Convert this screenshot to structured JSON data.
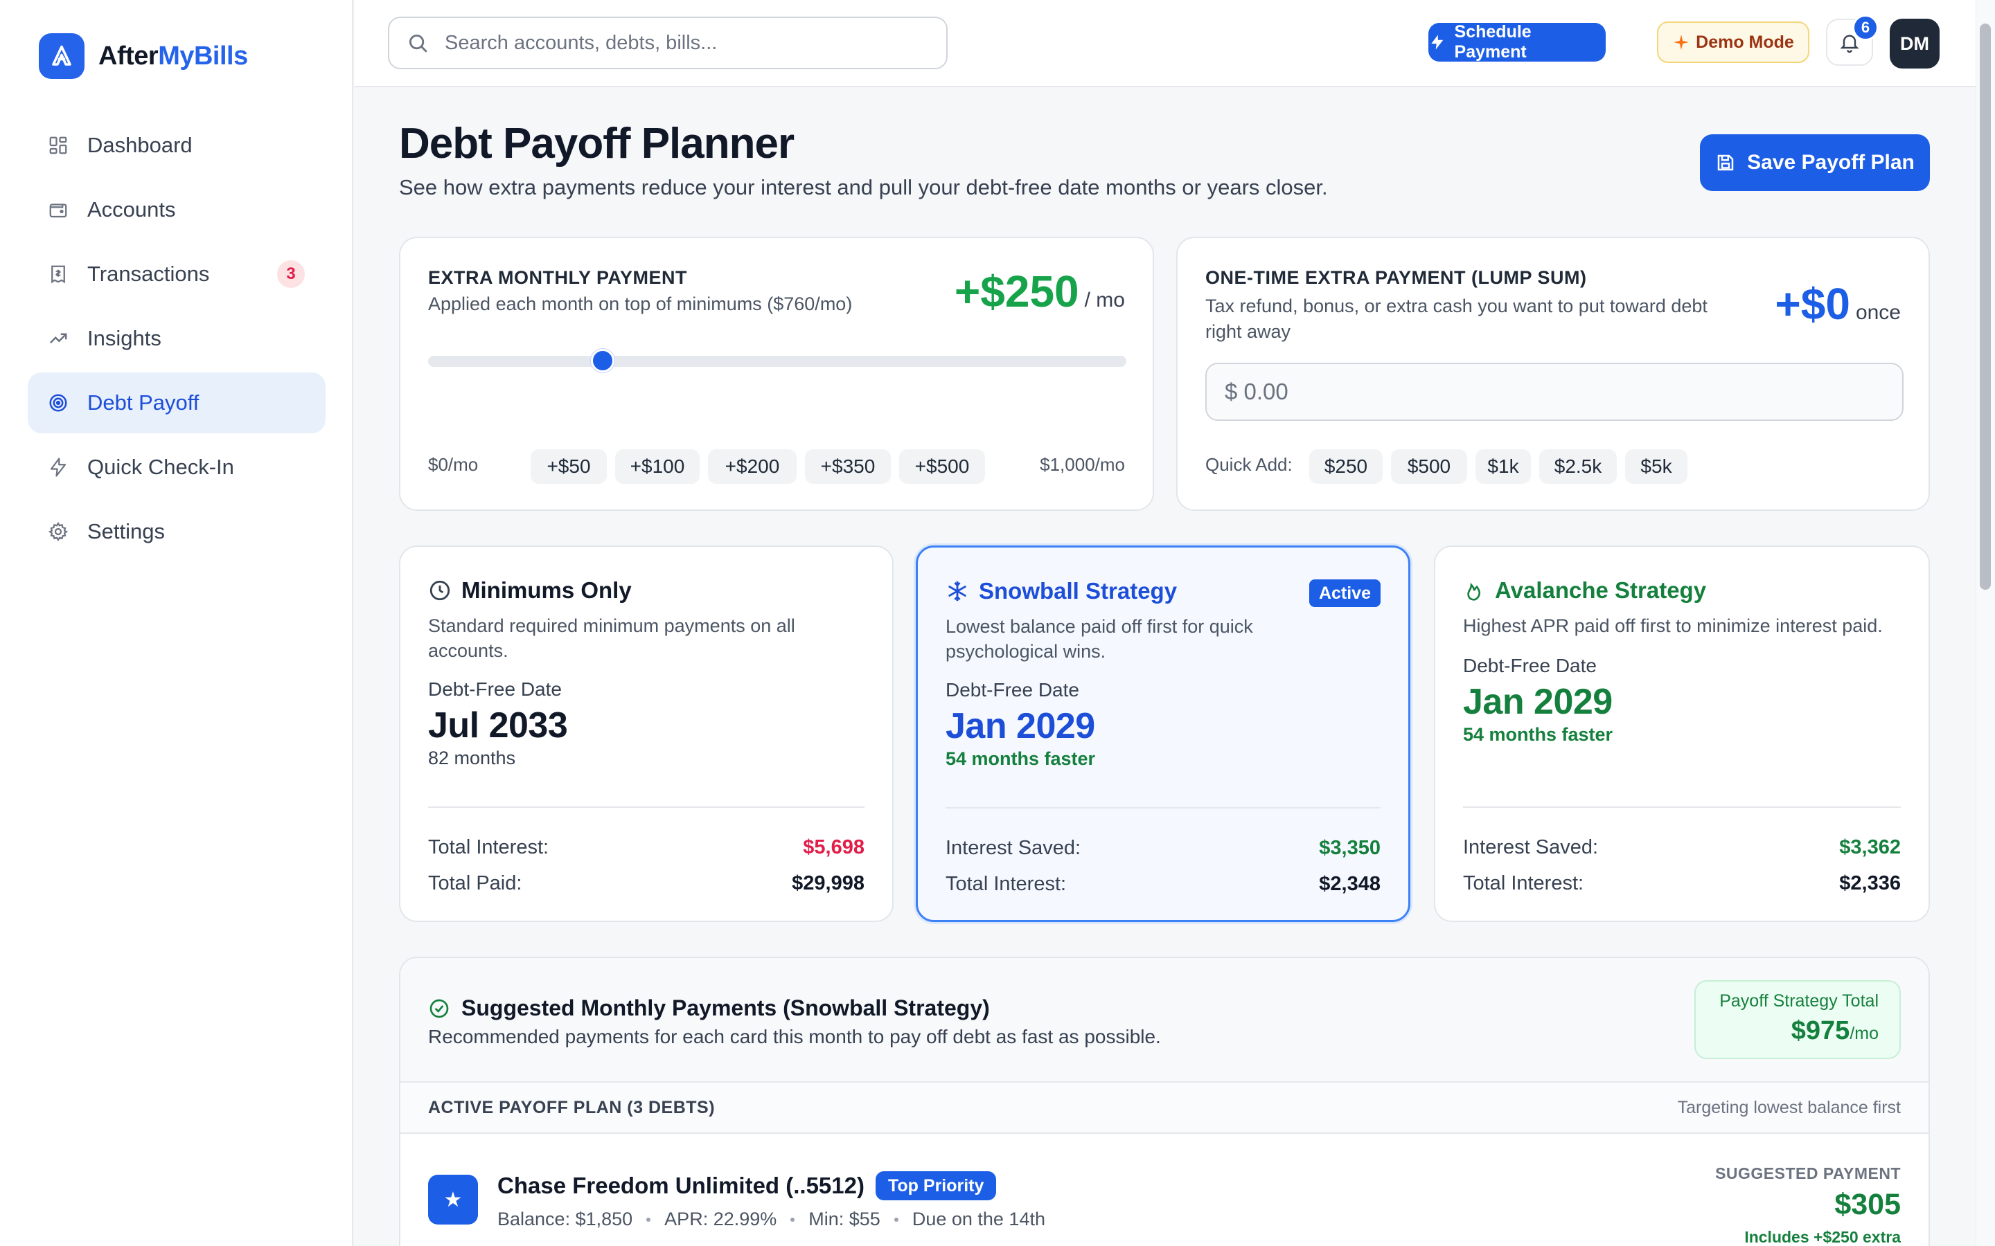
{
  "app": {
    "name_main": "After",
    "name_accent": "MyBills"
  },
  "sidebar": {
    "items": [
      {
        "label": "Dashboard",
        "icon": "dashboard-icon"
      },
      {
        "label": "Accounts",
        "icon": "wallet-icon"
      },
      {
        "label": "Transactions",
        "icon": "receipt-icon",
        "badge": "3"
      },
      {
        "label": "Insights",
        "icon": "trending-up-icon"
      },
      {
        "label": "Debt Payoff",
        "icon": "target-icon",
        "active": true
      },
      {
        "label": "Quick Check-In",
        "icon": "bolt-icon"
      },
      {
        "label": "Settings",
        "icon": "gear-icon"
      }
    ]
  },
  "topbar": {
    "search_placeholder": "Search accounts, debts, bills...",
    "schedule_label": "Schedule Payment",
    "demo_label": "Demo Mode",
    "notifications_count": "6",
    "avatar_initials": "DM"
  },
  "page": {
    "title": "Debt Payoff Planner",
    "subtitle": "See how extra payments reduce your interest and pull your debt-free date months or years closer.",
    "save_label": "Save Payoff Plan"
  },
  "extra_monthly": {
    "label": "EXTRA MONTHLY PAYMENT",
    "sublabel": "Applied each month on top of minimums ($760/mo)",
    "value": "+$250",
    "unit": "/ mo",
    "slider_fraction": 0.25,
    "min_label": "$0/mo",
    "max_label": "$1,000/mo",
    "chips": [
      "+$50",
      "+$100",
      "+$200",
      "+$350",
      "+$500"
    ]
  },
  "lump_sum": {
    "label": "ONE-TIME EXTRA PAYMENT (LUMP SUM)",
    "sublabel": "Tax refund, bonus, or extra cash you want to put toward debt right away",
    "value": "+$0",
    "unit": "once",
    "input_placeholder": "$ 0.00",
    "quick_add_label": "Quick Add:",
    "chips": [
      "$250",
      "$500",
      "$1k",
      "$2.5k",
      "$5k"
    ]
  },
  "strategies": {
    "minimums": {
      "title": "Minimums Only",
      "desc": "Standard required minimum payments on all accounts.",
      "dfd_label": "Debt-Free Date",
      "dfd": "Jul 2033",
      "note": "82 months",
      "row1_label": "Total Interest:",
      "row1_value": "$5,698",
      "row2_label": "Total Paid:",
      "row2_value": "$29,998"
    },
    "snowball": {
      "title": "Snowball Strategy",
      "badge": "Active",
      "desc": "Lowest balance paid off first for quick psychological wins.",
      "dfd_label": "Debt-Free Date",
      "dfd": "Jan 2029",
      "note": "54 months faster",
      "row1_label": "Interest Saved:",
      "row1_value": "$3,350",
      "row2_label": "Total Interest:",
      "row2_value": "$2,348"
    },
    "avalanche": {
      "title": "Avalanche Strategy",
      "desc": "Highest APR paid off first to minimize interest paid.",
      "dfd_label": "Debt-Free Date",
      "dfd": "Jan 2029",
      "note": "54 months faster",
      "row1_label": "Interest Saved:",
      "row1_value": "$3,362",
      "row2_label": "Total Interest:",
      "row2_value": "$2,336"
    }
  },
  "suggested": {
    "title": "Suggested Monthly Payments (Snowball Strategy)",
    "subtitle": "Recommended payments for each card this month to pay off debt as fast as possible.",
    "total_label": "Payoff Strategy Total",
    "total_value": "$975",
    "total_unit": "/mo",
    "plan_label": "ACTIVE PAYOFF PLAN (3 DEBTS)",
    "plan_note": "Targeting lowest balance first",
    "debts": [
      {
        "name": "Chase Freedom Unlimited (..5512)",
        "badge": "Top Priority",
        "balance": "Balance: $1,850",
        "apr": "APR: 22.99%",
        "min": "Min: $55",
        "due": "Due on the 14th",
        "sp_label": "SUGGESTED PAYMENT",
        "sp_value": "$305",
        "sp_extra": "Includes +$250 extra"
      }
    ]
  },
  "colors": {
    "accent": "#1d5ee6",
    "green": "#15803d",
    "red": "#e11d48",
    "text": "#111827"
  }
}
